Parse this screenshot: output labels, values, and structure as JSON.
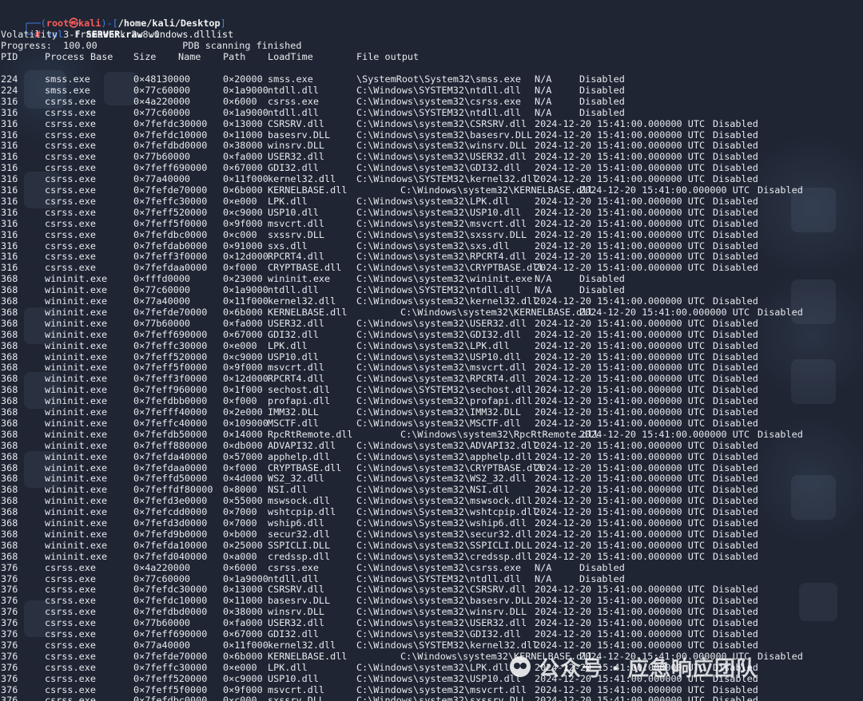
{
  "terminal": {
    "prompt": {
      "frame_left": "┌──(",
      "user": "root㉿kali",
      "frame_mid": ")-[",
      "path": "/home/kali/Desktop",
      "frame_right": "]",
      "second_prefix": "└─",
      "second_hash": "# ",
      "command": "vol",
      "args_before_file": " -f ",
      "file": "SERVER.raw",
      "plugin": " windows.dlllist"
    },
    "header": {
      "version": "Volatility 3 Framework 2.8.0",
      "progress": "Progress:  100.00\t\tPDB scanning finished",
      "columns": [
        "PID",
        "Process",
        "Base",
        "Size",
        "Name",
        "Path",
        "LoadTime",
        "File output"
      ]
    },
    "rows": [
      {
        "pid": "224",
        "process": "smss.exe",
        "base": "0×48130000",
        "size": "0×20000",
        "name": "smss.exe",
        "path": "\\SystemRoot\\System32\\smss.exe",
        "time": "N/A",
        "output": "Disabled"
      },
      {
        "pid": "224",
        "process": "smss.exe",
        "base": "0×77c60000",
        "size": "0×1a9000",
        "name": "ntdll.dll",
        "path": "C:\\Windows\\SYSTEM32\\ntdll.dll",
        "time": "N/A",
        "output": "Disabled"
      },
      {
        "pid": "316",
        "process": "csrss.exe",
        "base": "0×4a220000",
        "size": "0×6000",
        "name": "csrss.exe",
        "path": "C:\\Windows\\system32\\csrss.exe",
        "time": "N/A",
        "output": "Disabled"
      },
      {
        "pid": "316",
        "process": "csrss.exe",
        "base": "0×77c60000",
        "size": "0×1a9000",
        "name": "ntdll.dll",
        "path": "C:\\Windows\\SYSTEM32\\ntdll.dll",
        "time": "N/A",
        "output": "Disabled"
      },
      {
        "pid": "316",
        "process": "csrss.exe",
        "base": "0×7fefdc30000",
        "size": "0×13000",
        "name": "CSRSRV.dll",
        "path": "C:\\Windows\\system32\\CSRSRV.dll",
        "time": "2024-12-20 15:41:00.000000 UTC",
        "output": "Disabled"
      },
      {
        "pid": "316",
        "process": "csrss.exe",
        "base": "0×7fefdc10000",
        "size": "0×11000",
        "name": "basesrv.DLL",
        "path": "C:\\Windows\\system32\\basesrv.DLL",
        "time": "2024-12-20 15:41:00.000000 UTC",
        "output": "Disabled"
      },
      {
        "pid": "316",
        "process": "csrss.exe",
        "base": "0×7fefdbd0000",
        "size": "0×38000",
        "name": "winsrv.DLL",
        "path": "C:\\Windows\\system32\\winsrv.DLL",
        "time": "2024-12-20 15:41:00.000000 UTC",
        "output": "Disabled"
      },
      {
        "pid": "316",
        "process": "csrss.exe",
        "base": "0×77b60000",
        "size": "0×fa000",
        "name": "USER32.dll",
        "path": "C:\\Windows\\system32\\USER32.dll",
        "time": "2024-12-20 15:41:00.000000 UTC",
        "output": "Disabled"
      },
      {
        "pid": "316",
        "process": "csrss.exe",
        "base": "0×7feff690000",
        "size": "0×67000",
        "name": "GDI32.dll",
        "path": "C:\\Windows\\system32\\GDI32.dll",
        "time": "2024-12-20 15:41:00.000000 UTC",
        "output": "Disabled"
      },
      {
        "pid": "316",
        "process": "csrss.exe",
        "base": "0×77a40000",
        "size": "0×11f000",
        "name": "kernel32.dll",
        "path": "C:\\Windows\\SYSTEM32\\kernel32.dll",
        "time": "2024-12-20 15:41:00.000000 UTC",
        "output": "Disabled"
      },
      {
        "pid": "316",
        "process": "csrss.exe",
        "base": "0×7fefde70000",
        "size": "0×6b000",
        "name": "KERNELBASE.dll",
        "path": "C:\\Windows\\system32\\KERNELBASE.dll",
        "time": "2024-12-20 15:41:00.000000 UTC",
        "output": "Disabled"
      },
      {
        "pid": "316",
        "process": "csrss.exe",
        "base": "0×7feffc30000",
        "size": "0×e000",
        "name": "LPK.dll",
        "path": "C:\\Windows\\system32\\LPK.dll",
        "time": "2024-12-20 15:41:00.000000 UTC",
        "output": "Disabled"
      },
      {
        "pid": "316",
        "process": "csrss.exe",
        "base": "0×7feff520000",
        "size": "0×c9000",
        "name": "USP10.dll",
        "path": "C:\\Windows\\system32\\USP10.dll",
        "time": "2024-12-20 15:41:00.000000 UTC",
        "output": "Disabled"
      },
      {
        "pid": "316",
        "process": "csrss.exe",
        "base": "0×7feff5f0000",
        "size": "0×9f000",
        "name": "msvcrt.dll",
        "path": "C:\\Windows\\system32\\msvcrt.dll",
        "time": "2024-12-20 15:41:00.000000 UTC",
        "output": "Disabled"
      },
      {
        "pid": "316",
        "process": "csrss.exe",
        "base": "0×7fefdbc0000",
        "size": "0×c000",
        "name": "sxssrv.DLL",
        "path": "C:\\Windows\\system32\\sxssrv.DLL",
        "time": "2024-12-20 15:41:00.000000 UTC",
        "output": "Disabled"
      },
      {
        "pid": "316",
        "process": "csrss.exe",
        "base": "0×7fefdab0000",
        "size": "0×91000",
        "name": "sxs.dll",
        "path": "C:\\Windows\\system32\\sxs.dll",
        "time": "2024-12-20 15:41:00.000000 UTC",
        "output": "Disabled"
      },
      {
        "pid": "316",
        "process": "csrss.exe",
        "base": "0×7feff3f0000",
        "size": "0×12d000",
        "name": "RPCRT4.dll",
        "path": "C:\\Windows\\system32\\RPCRT4.dll",
        "time": "2024-12-20 15:41:00.000000 UTC",
        "output": "Disabled"
      },
      {
        "pid": "316",
        "process": "csrss.exe",
        "base": "0×7fefdaa0000",
        "size": "0×f000",
        "name": "CRYPTBASE.dll",
        "path": "C:\\Windows\\system32\\CRYPTBASE.dll",
        "time": "2024-12-20 15:41:00.000000 UTC",
        "output": "Disabled"
      },
      {
        "pid": "368",
        "process": "wininit.exe",
        "base": "0×fffd0000",
        "size": "0×23000",
        "name": "wininit.exe",
        "path": "C:\\Windows\\system32\\wininit.exe",
        "time": "N/A",
        "output": "Disabled"
      },
      {
        "pid": "368",
        "process": "wininit.exe",
        "base": "0×77c60000",
        "size": "0×1a9000",
        "name": "ntdll.dll",
        "path": "C:\\Windows\\SYSTEM32\\ntdll.dll",
        "time": "N/A",
        "output": "Disabled"
      },
      {
        "pid": "368",
        "process": "wininit.exe",
        "base": "0×77a40000",
        "size": "0×11f000",
        "name": "kernel32.dll",
        "path": "C:\\Windows\\system32\\kernel32.dll",
        "time": "2024-12-20 15:41:00.000000 UTC",
        "output": "Disabled"
      },
      {
        "pid": "368",
        "process": "wininit.exe",
        "base": "0×7fefde70000",
        "size": "0×6b000",
        "name": "KERNELBASE.dll",
        "path": "C:\\Windows\\system32\\KERNELBASE.dll",
        "time": "2024-12-20 15:41:00.000000 UTC",
        "output": "Disabled"
      },
      {
        "pid": "368",
        "process": "wininit.exe",
        "base": "0×77b60000",
        "size": "0×fa000",
        "name": "USER32.dll",
        "path": "C:\\Windows\\system32\\USER32.dll",
        "time": "2024-12-20 15:41:00.000000 UTC",
        "output": "Disabled"
      },
      {
        "pid": "368",
        "process": "wininit.exe",
        "base": "0×7feff690000",
        "size": "0×67000",
        "name": "GDI32.dll",
        "path": "C:\\Windows\\system32\\GDI32.dll",
        "time": "2024-12-20 15:41:00.000000 UTC",
        "output": "Disabled"
      },
      {
        "pid": "368",
        "process": "wininit.exe",
        "base": "0×7feffc30000",
        "size": "0×e000",
        "name": "LPK.dll",
        "path": "C:\\Windows\\system32\\LPK.dll",
        "time": "2024-12-20 15:41:00.000000 UTC",
        "output": "Disabled"
      },
      {
        "pid": "368",
        "process": "wininit.exe",
        "base": "0×7feff520000",
        "size": "0×c9000",
        "name": "USP10.dll",
        "path": "C:\\Windows\\system32\\USP10.dll",
        "time": "2024-12-20 15:41:00.000000 UTC",
        "output": "Disabled"
      },
      {
        "pid": "368",
        "process": "wininit.exe",
        "base": "0×7feff5f0000",
        "size": "0×9f000",
        "name": "msvcrt.dll",
        "path": "C:\\Windows\\system32\\msvcrt.dll",
        "time": "2024-12-20 15:41:00.000000 UTC",
        "output": "Disabled"
      },
      {
        "pid": "368",
        "process": "wininit.exe",
        "base": "0×7feff3f0000",
        "size": "0×12d000",
        "name": "RPCRT4.dll",
        "path": "C:\\Windows\\system32\\RPCRT4.dll",
        "time": "2024-12-20 15:41:00.000000 UTC",
        "output": "Disabled"
      },
      {
        "pid": "368",
        "process": "wininit.exe",
        "base": "0×7feff960000",
        "size": "0×1f000",
        "name": "sechost.dll",
        "path": "C:\\Windows\\SYSTEM32\\sechost.dll",
        "time": "2024-12-20 15:41:00.000000 UTC",
        "output": "Disabled"
      },
      {
        "pid": "368",
        "process": "wininit.exe",
        "base": "0×7fefdbb0000",
        "size": "0×f000",
        "name": "profapi.dll",
        "path": "C:\\Windows\\system32\\profapi.dll",
        "time": "2024-12-20 15:41:00.000000 UTC",
        "output": "Disabled"
      },
      {
        "pid": "368",
        "process": "wininit.exe",
        "base": "0×7fefff40000",
        "size": "0×2e000",
        "name": "IMM32.DLL",
        "path": "C:\\Windows\\system32\\IMM32.DLL",
        "time": "2024-12-20 15:41:00.000000 UTC",
        "output": "Disabled"
      },
      {
        "pid": "368",
        "process": "wininit.exe",
        "base": "0×7feffc40000",
        "size": "0×109000",
        "name": "MSCTF.dll",
        "path": "C:\\Windows\\system32\\MSCTF.dll",
        "time": "2024-12-20 15:41:00.000000 UTC",
        "output": "Disabled"
      },
      {
        "pid": "368",
        "process": "wininit.exe",
        "base": "0×7fefdb50000",
        "size": "0×14000",
        "name": "RpcRtRemote.dll",
        "path": "C:\\Windows\\system32\\RpcRtRemote.dll",
        "time": "2024-12-20 15:41:00.000000 UTC",
        "output": "Disabled"
      },
      {
        "pid": "368",
        "process": "wininit.exe",
        "base": "0×7feff880000",
        "size": "0×db000",
        "name": "ADVAPI32.dll",
        "path": "C:\\Windows\\system32\\ADVAPI32.dll",
        "time": "2024-12-20 15:41:00.000000 UTC",
        "output": "Disabled"
      },
      {
        "pid": "368",
        "process": "wininit.exe",
        "base": "0×7fefda40000",
        "size": "0×57000",
        "name": "apphelp.dll",
        "path": "C:\\Windows\\system32\\apphelp.dll",
        "time": "2024-12-20 15:41:00.000000 UTC",
        "output": "Disabled"
      },
      {
        "pid": "368",
        "process": "wininit.exe",
        "base": "0×7fefdaa0000",
        "size": "0×f000",
        "name": "CRYPTBASE.dll",
        "path": "C:\\Windows\\system32\\CRYPTBASE.dll",
        "time": "2024-12-20 15:41:00.000000 UTC",
        "output": "Disabled"
      },
      {
        "pid": "368",
        "process": "wininit.exe",
        "base": "0×7feffd50000",
        "size": "0×4d000",
        "name": "WS2_32.dll",
        "path": "C:\\Windows\\system32\\WS2_32.dll",
        "time": "2024-12-20 15:41:00.000000 UTC",
        "output": "Disabled"
      },
      {
        "pid": "368",
        "process": "wininit.exe",
        "base": "0×7feffdf80000",
        "size": "0×8000",
        "name": "NSI.dll",
        "path": "C:\\Windows\\system32\\NSI.dll",
        "time": "2024-12-20 15:41:00.000000 UTC",
        "output": "Disabled"
      },
      {
        "pid": "368",
        "process": "wininit.exe",
        "base": "0×7fefd3e0000",
        "size": "0×55000",
        "name": "mswsock.dll",
        "path": "C:\\Windows\\system32\\mswsock.dll",
        "time": "2024-12-20 15:41:00.000000 UTC",
        "output": "Disabled"
      },
      {
        "pid": "368",
        "process": "wininit.exe",
        "base": "0×7fefcdd0000",
        "size": "0×7000",
        "name": "wshtcpip.dll",
        "path": "C:\\Windows\\System32\\wshtcpip.dll",
        "time": "2024-12-20 15:41:00.000000 UTC",
        "output": "Disabled"
      },
      {
        "pid": "368",
        "process": "wininit.exe",
        "base": "0×7fefd3d0000",
        "size": "0×7000",
        "name": "wship6.dll",
        "path": "C:\\Windows\\System32\\wship6.dll",
        "time": "2024-12-20 15:41:00.000000 UTC",
        "output": "Disabled"
      },
      {
        "pid": "368",
        "process": "wininit.exe",
        "base": "0×7fefd9b0000",
        "size": "0×b000",
        "name": "secur32.dll",
        "path": "C:\\Windows\\system32\\secur32.dll",
        "time": "2024-12-20 15:41:00.000000 UTC",
        "output": "Disabled"
      },
      {
        "pid": "368",
        "process": "wininit.exe",
        "base": "0×7fefda10000",
        "size": "0×25000",
        "name": "SSPICLI.DLL",
        "path": "C:\\Windows\\system32\\SSPICLI.DLL",
        "time": "2024-12-20 15:41:00.000000 UTC",
        "output": "Disabled"
      },
      {
        "pid": "368",
        "process": "wininit.exe",
        "base": "0×7fefd040000",
        "size": "0×a000",
        "name": "credssp.dll",
        "path": "C:\\Windows\\system32\\credssp.dll",
        "time": "2024-12-20 15:41:00.000000 UTC",
        "output": "Disabled"
      },
      {
        "pid": "376",
        "process": "csrss.exe",
        "base": "0×4a220000",
        "size": "0×6000",
        "name": "csrss.exe",
        "path": "C:\\Windows\\system32\\csrss.exe",
        "time": "N/A",
        "output": "Disabled"
      },
      {
        "pid": "376",
        "process": "csrss.exe",
        "base": "0×77c60000",
        "size": "0×1a9000",
        "name": "ntdll.dll",
        "path": "C:\\Windows\\SYSTEM32\\ntdll.dll",
        "time": "N/A",
        "output": "Disabled"
      },
      {
        "pid": "376",
        "process": "csrss.exe",
        "base": "0×7fefdc30000",
        "size": "0×13000",
        "name": "CSRSRV.dll",
        "path": "C:\\Windows\\system32\\CSRSRV.dll",
        "time": "2024-12-20 15:41:00.000000 UTC",
        "output": "Disabled"
      },
      {
        "pid": "376",
        "process": "csrss.exe",
        "base": "0×7fefdc10000",
        "size": "0×11000",
        "name": "basesrv.DLL",
        "path": "C:\\Windows\\system32\\basesrv.DLL",
        "time": "2024-12-20 15:41:00.000000 UTC",
        "output": "Disabled"
      },
      {
        "pid": "376",
        "process": "csrss.exe",
        "base": "0×7fefdbd0000",
        "size": "0×38000",
        "name": "winsrv.DLL",
        "path": "C:\\Windows\\system32\\winsrv.DLL",
        "time": "2024-12-20 15:41:00.000000 UTC",
        "output": "Disabled"
      },
      {
        "pid": "376",
        "process": "csrss.exe",
        "base": "0×77b60000",
        "size": "0×fa000",
        "name": "USER32.dll",
        "path": "C:\\Windows\\system32\\USER32.dll",
        "time": "2024-12-20 15:41:00.000000 UTC",
        "output": "Disabled"
      },
      {
        "pid": "376",
        "process": "csrss.exe",
        "base": "0×7feff690000",
        "size": "0×67000",
        "name": "GDI32.dll",
        "path": "C:\\Windows\\system32\\GDI32.dll",
        "time": "2024-12-20 15:41:00.000000 UTC",
        "output": "Disabled"
      },
      {
        "pid": "376",
        "process": "csrss.exe",
        "base": "0×77a40000",
        "size": "0×11f000",
        "name": "kernel32.dll",
        "path": "C:\\Windows\\SYSTEM32\\kernel32.dll",
        "time": "2024-12-20 15:41:00.000000 UTC",
        "output": "Disabled"
      },
      {
        "pid": "376",
        "process": "csrss.exe",
        "base": "0×7fefde70000",
        "size": "0×6b000",
        "name": "KERNELBASE.dll",
        "path": "C:\\Windows\\system32\\KERNELBASE.dll",
        "time": "2024-12-20 15:41:00.000000 UTC",
        "output": "Disabled"
      },
      {
        "pid": "376",
        "process": "csrss.exe",
        "base": "0×7feffc30000",
        "size": "0×e000",
        "name": "LPK.dll",
        "path": "C:\\Windows\\system32\\LPK.dll",
        "time": "2024-12-20 15:41:00.000000 UTC",
        "output": "Disabled"
      },
      {
        "pid": "376",
        "process": "csrss.exe",
        "base": "0×7feff520000",
        "size": "0×c9000",
        "name": "USP10.dll",
        "path": "C:\\Windows\\system32\\USP10.dll",
        "time": "2024-12-20 15:41:00.000000 UTC",
        "output": "Disabled"
      },
      {
        "pid": "376",
        "process": "csrss.exe",
        "base": "0×7feff5f0000",
        "size": "0×9f000",
        "name": "msvcrt.dll",
        "path": "C:\\Windows\\system32\\msvcrt.dll",
        "time": "2024-12-20 15:41:00.000000 UTC",
        "output": "Disabled"
      },
      {
        "pid": "376",
        "process": "csrss.exe",
        "base": "0×7fefdbc0000",
        "size": "0×c000",
        "name": "sxssrv.DLL",
        "path": "C:\\Windows\\system32\\sxssrv.DLL",
        "time": "2024-12-20 15:41:00.000000 UTC",
        "output": "Disabled"
      }
    ],
    "watermark": "公众号 · 应急响应团队"
  },
  "colors": {
    "background": "#1f2533",
    "text": "#e7e9ee",
    "prompt_blue": "#3f7fe0",
    "prompt_red": "#ff5c5c"
  }
}
